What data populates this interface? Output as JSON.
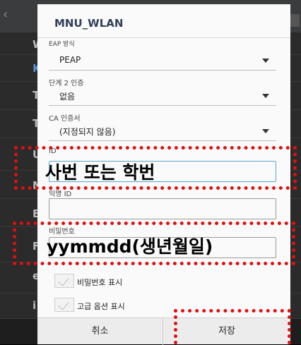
{
  "dialog": {
    "title": "MNU_WLAN",
    "eap_method": {
      "label": "EAP 방식",
      "value": "PEAP"
    },
    "phase2_auth": {
      "label": "단계 2 인증",
      "value": "없음"
    },
    "ca_cert": {
      "label": "CA 인증서",
      "value": "(지정되지 않음)"
    },
    "identity": {
      "label": "ID",
      "value": ""
    },
    "anonymous_id": {
      "label": "익명 ID",
      "value": ""
    },
    "password": {
      "label": "비밀번호",
      "value": ""
    },
    "show_password": {
      "label": "비밀번호 표시",
      "checked": false
    },
    "advanced_options": {
      "label": "고급 옵션 표시",
      "checked": false
    },
    "cancel_label": "취소",
    "save_label": "저장"
  },
  "annotations": {
    "id_hint": "사번 또는 학번",
    "password_hint": "yymmdd(생년월일)",
    "color": "#e01010"
  },
  "background": {
    "letters": [
      "W",
      "K",
      "T",
      "T",
      "U",
      "M",
      "E",
      "F",
      "e",
      "i"
    ]
  }
}
